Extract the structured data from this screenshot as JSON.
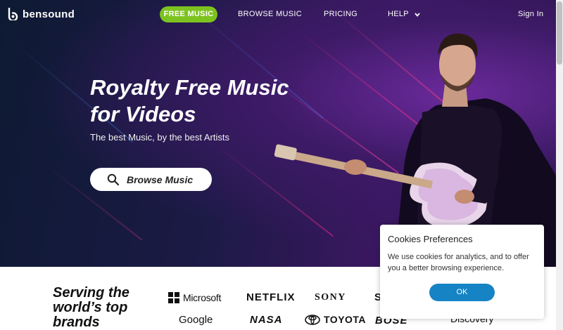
{
  "nav": {
    "logo_text": "bensound",
    "free_music": "FREE MUSIC",
    "browse_music": "BROWSE MUSIC",
    "pricing": "PRICING",
    "help": "HELP",
    "sign_in": "Sign In"
  },
  "hero": {
    "title_line1": "Royalty Free Music",
    "title_line2": "for Videos",
    "subtitle": "The best Music, by the best Artists",
    "button_label": "Browse Music"
  },
  "brands": {
    "title_line1": "Serving the",
    "title_line2": "world’s top",
    "title_line3": "brands",
    "logos": [
      "Microsoft",
      "NETFLIX",
      "SONY",
      "S",
      "Google",
      "NASA",
      "TOYOTA",
      "BOSE",
      "Discovery"
    ]
  },
  "cookie": {
    "title": "Cookies Preferences",
    "text": "We use cookies for analytics, and to offer you a better browsing experience.",
    "ok": "OK"
  },
  "colors": {
    "accent_green": "#7dc31f",
    "cookie_button": "#1683c4"
  }
}
